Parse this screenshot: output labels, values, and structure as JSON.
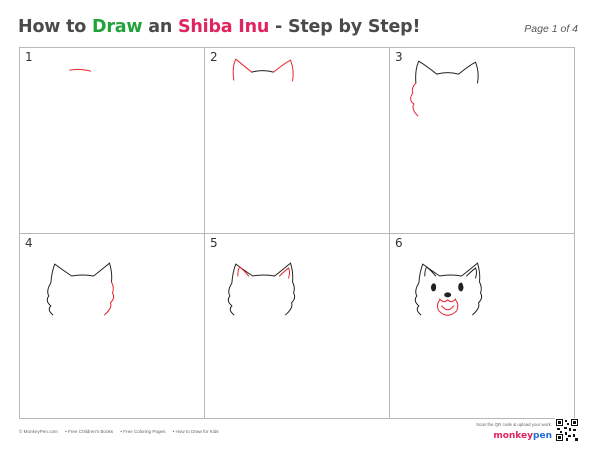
{
  "header": {
    "title_part1": "How to ",
    "title_draw": "Draw",
    "title_part2": " an ",
    "title_subject": "Shiba Inu",
    "title_part3": " - Step by Step!",
    "page_label": "Page 1 of 4"
  },
  "steps": [
    {
      "number": "1"
    },
    {
      "number": "2"
    },
    {
      "number": "3"
    },
    {
      "number": "4"
    },
    {
      "number": "5"
    },
    {
      "number": "6"
    }
  ],
  "colors": {
    "line_black": "#222222",
    "line_red": "#e8232f",
    "accent_green": "#22a23a",
    "accent_pink": "#e0245e"
  },
  "footer": {
    "links": [
      "© MonkeyPen.com",
      "• Free Children's Books",
      "• Free Coloring Pages",
      "• How to Draw for Kids"
    ],
    "qr_caption": "Scan the QR code & upload your work.",
    "logo_part1": "monkey",
    "logo_part2": "pen"
  }
}
